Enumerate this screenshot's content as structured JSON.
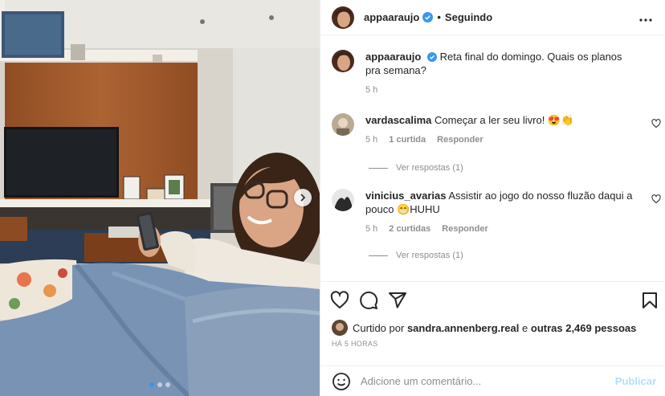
{
  "post": {
    "username": "appaaraujo",
    "following_label": "Seguindo",
    "separator": "•"
  },
  "caption": {
    "username": "appaaraujo",
    "text": "Reta final do domingo. Quais os planos pra semana?",
    "time": "5 h"
  },
  "comments": [
    {
      "username": "vardascalima",
      "text": "Começar a ler seu livro! 😍👏",
      "time": "5 h",
      "likes": "1 curtida",
      "reply_label": "Responder",
      "view_replies": "Ver respostas (1)"
    },
    {
      "username": "vinicius_avarias",
      "text": "Assistir ao jogo do nosso fluzão daqui a pouco 😁HUHU",
      "time": "5 h",
      "likes": "2 curtidas",
      "reply_label": "Responder",
      "view_replies": "Ver respostas (1)"
    }
  ],
  "liked_by": {
    "prefix": "Curtido por",
    "user": "sandra.annenberg.real",
    "middle": "e",
    "others": "outras 2,469 pessoas"
  },
  "timestamp": "HÁ 5 HORAS",
  "add_comment": {
    "placeholder": "Adicione um comentário...",
    "publish_label": "Publicar"
  },
  "carousel": {
    "slides": 3,
    "active_index": 0
  },
  "colors": {
    "verified": "#3897f0",
    "publish_disabled": "#b2dffc",
    "muted": "#8e8e8e"
  },
  "icons": [
    "verified-badge-icon",
    "more-options-icon",
    "heart-icon",
    "comment-icon",
    "share-icon",
    "save-icon",
    "emoji-icon",
    "chevron-right-icon"
  ]
}
